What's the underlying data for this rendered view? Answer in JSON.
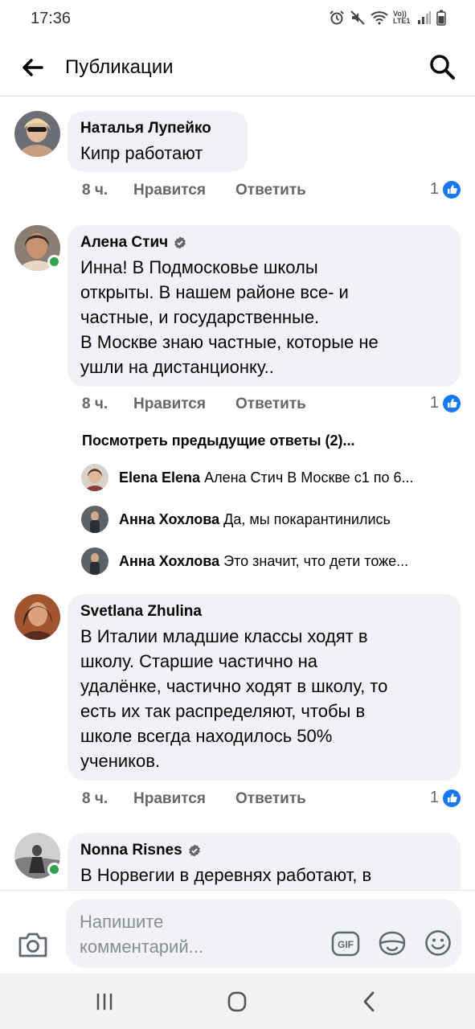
{
  "status_bar": {
    "time": "17:36",
    "network": "Vo)) LTE1"
  },
  "header": {
    "title": "Публикации"
  },
  "comments": [
    {
      "author": "Наталья Лупейко",
      "text": "Кипр работают",
      "time": "8 ч.",
      "like_label": "Нравится",
      "reply_label": "Ответить",
      "reaction_count": "1"
    },
    {
      "author": "Алена Стич",
      "text": "Инна! В Подмосковье школы\nоткрыты. В нашем районе все- и\nчастные, и государственные.\nВ Москве знаю частные, которые не\nушли на дистанционку..",
      "time": "8 ч.",
      "like_label": "Нравится",
      "reply_label": "Ответить",
      "reaction_count": "1"
    },
    {
      "author": "Svetlana Zhulina",
      "text": "В Италии младшие классы ходят в\nшколу. Старшие частично на\nудалёнке, частично ходят в школу, то\nесть их так распределяют, чтобы в\nшколе всегда  находилось 50%\nучеников.",
      "time": "8 ч.",
      "like_label": "Нравится",
      "reply_label": "Ответить",
      "reaction_count": "1"
    },
    {
      "author": "Nonna Risnes",
      "text": "В Норвегии в деревнях работают, в"
    }
  ],
  "replies_section": {
    "view_previous": "Посмотреть предыдущие ответы (2)...",
    "replies": [
      {
        "name": "Elena Elena",
        "text": "Алена Стич В Москве с1 по 6..."
      },
      {
        "name": "Анна Хохлова",
        "text": "Да, мы покарантинились"
      },
      {
        "name": "Анна Хохлова",
        "text": "Это значит, что дети тоже..."
      }
    ]
  },
  "composer": {
    "placeholder": "Напишите\nкомментарий...",
    "gif_label": "GIF"
  },
  "colors": {
    "accent": "#1877f2",
    "bubble": "#f0f2f5",
    "online": "#31a24c",
    "secondary_text": "#65676b"
  }
}
